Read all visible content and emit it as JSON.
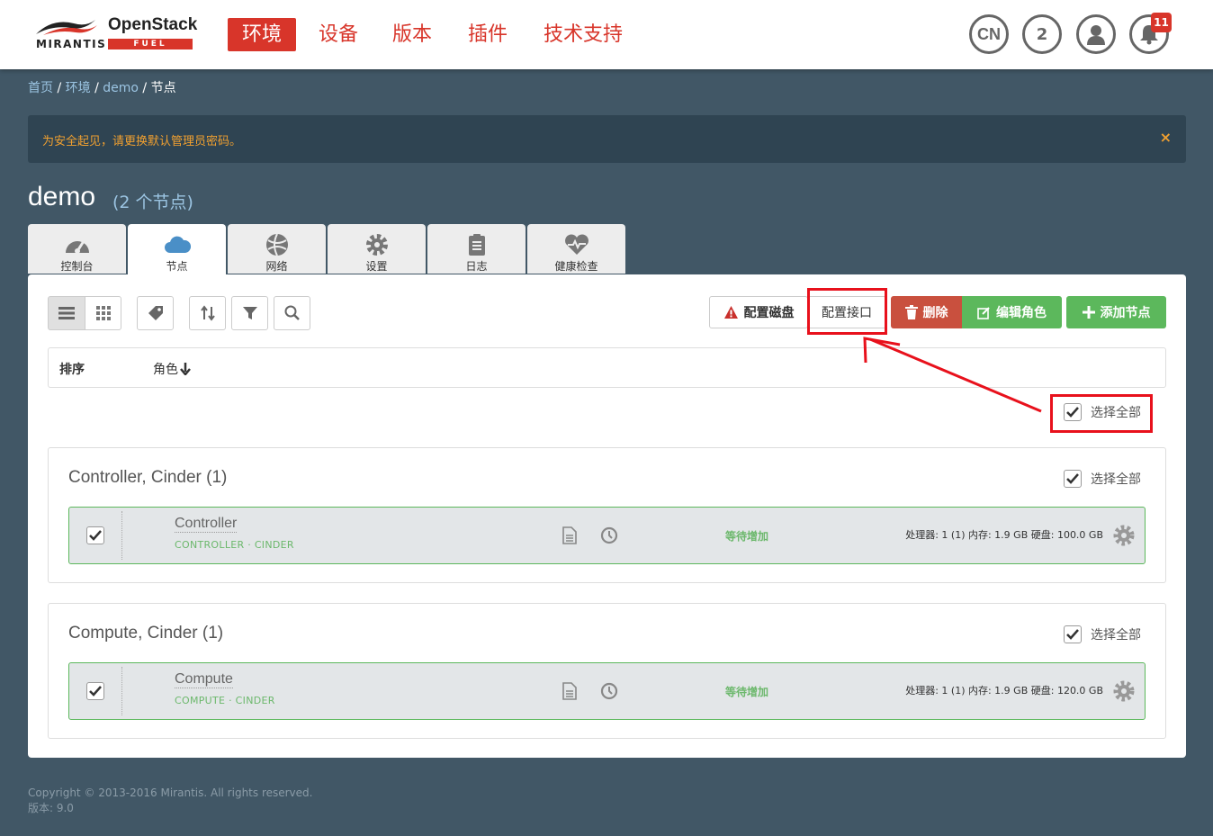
{
  "header": {
    "logo_mirantis": "MIRANTIS",
    "logo_openstack": "OpenStack",
    "logo_fuel": "FUEL",
    "nav": [
      "环境",
      "设备",
      "版本",
      "插件",
      "技术支持"
    ],
    "lang": "CN",
    "count_badge": "2",
    "notifications": "11",
    "brand_color": "#d8352a"
  },
  "breadcrumb": {
    "home": "首页",
    "env": "环境",
    "cluster": "demo",
    "current": "节点"
  },
  "alert": {
    "text": "为安全起见，请更换默认管理员密码。",
    "close": "×"
  },
  "page": {
    "title": "demo",
    "count": "(2 个节点)"
  },
  "tabs": [
    {
      "label": "控制台",
      "icon": "dashboard-icon"
    },
    {
      "label": "节点",
      "icon": "cloud-icon"
    },
    {
      "label": "网络",
      "icon": "network-icon"
    },
    {
      "label": "设置",
      "icon": "gear-icon"
    },
    {
      "label": "日志",
      "icon": "clipboard-icon"
    },
    {
      "label": "健康检查",
      "icon": "heart-icon"
    }
  ],
  "toolbar": {
    "config_disks": "配置磁盘",
    "config_interfaces": "配置接口",
    "delete": "删除",
    "edit_roles": "编辑角色",
    "add_nodes": "添加节点"
  },
  "sortbar": {
    "label": "排序",
    "field": "角色"
  },
  "select_all": "选择全部",
  "groups": [
    {
      "title": "Controller, Cinder (1)",
      "node": {
        "name": "Controller",
        "roles": "CONTROLLER · CINDER",
        "status": "等待增加",
        "spec": "处理器: 1 (1) 内存: 1.9 GB 硬盘: 100.0 GB"
      }
    },
    {
      "title": "Compute, Cinder (1)",
      "node": {
        "name": "Compute",
        "roles": "COMPUTE · CINDER",
        "status": "等待增加",
        "spec": "处理器: 1 (1) 内存: 1.9 GB 硬盘: 120.0 GB"
      }
    }
  ],
  "footer": {
    "copyright": "Copyright © 2013-2016 Mirantis. All rights reserved.",
    "version": "版本: 9.0"
  }
}
